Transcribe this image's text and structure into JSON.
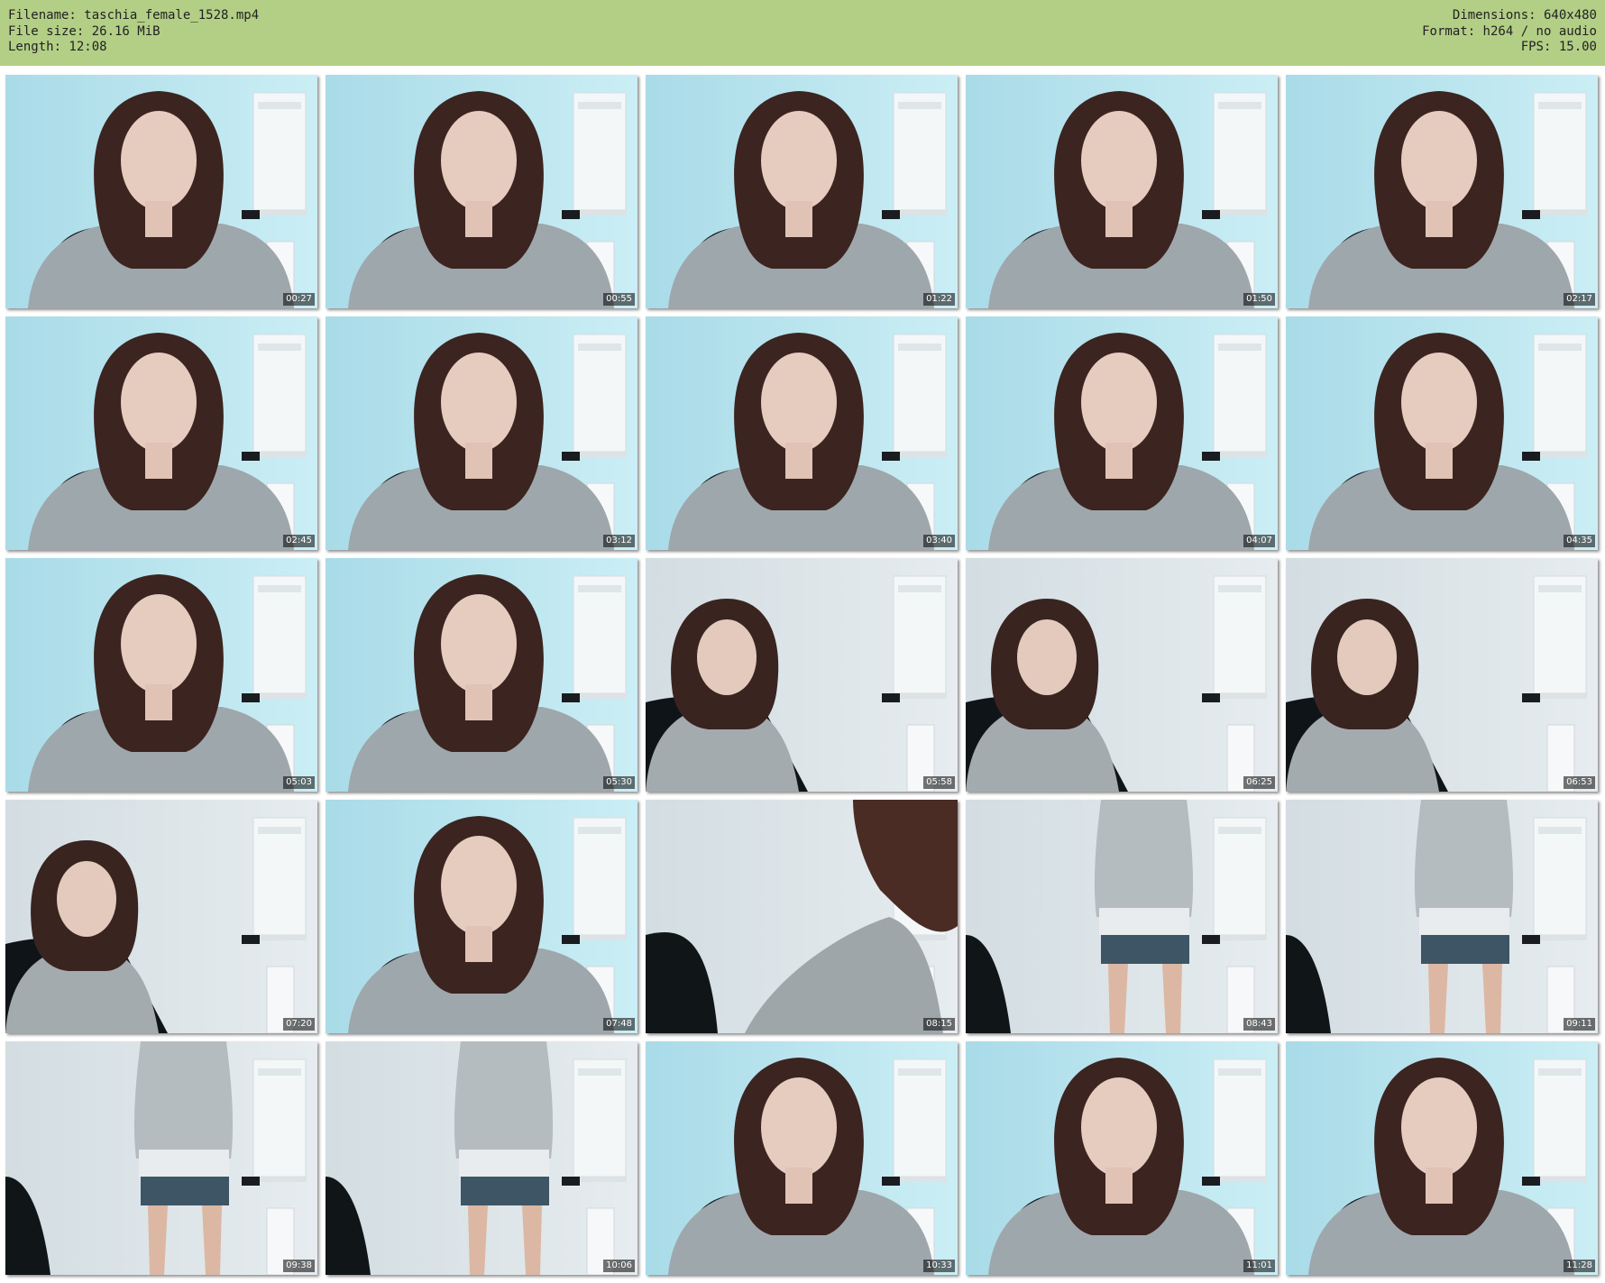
{
  "header": {
    "filename": "Filename: taschia_female_1528.mp4",
    "filesize": "File size: 26.16 MiB",
    "length": "Length: 12:08",
    "dimensions": "Dimensions: 640x480",
    "format": "Format: h264 / no audio",
    "fps": "FPS: 15.00"
  },
  "thumbnails": [
    {
      "time": "00:27",
      "scene": "face"
    },
    {
      "time": "00:55",
      "scene": "face"
    },
    {
      "time": "01:22",
      "scene": "face"
    },
    {
      "time": "01:50",
      "scene": "face"
    },
    {
      "time": "02:17",
      "scene": "face"
    },
    {
      "time": "02:45",
      "scene": "face"
    },
    {
      "time": "03:12",
      "scene": "face"
    },
    {
      "time": "03:40",
      "scene": "face"
    },
    {
      "time": "04:07",
      "scene": "face"
    },
    {
      "time": "04:35",
      "scene": "face"
    },
    {
      "time": "05:03",
      "scene": "face"
    },
    {
      "time": "05:30",
      "scene": "face"
    },
    {
      "time": "05:58",
      "scene": "seated-left"
    },
    {
      "time": "06:25",
      "scene": "seated-left"
    },
    {
      "time": "06:53",
      "scene": "seated-left"
    },
    {
      "time": "07:20",
      "scene": "seated-left"
    },
    {
      "time": "07:48",
      "scene": "face"
    },
    {
      "time": "08:15",
      "scene": "blur"
    },
    {
      "time": "08:43",
      "scene": "standing"
    },
    {
      "time": "09:11",
      "scene": "standing"
    },
    {
      "time": "09:38",
      "scene": "standing"
    },
    {
      "time": "10:06",
      "scene": "standing"
    },
    {
      "time": "10:33",
      "scene": "face"
    },
    {
      "time": "11:01",
      "scene": "face"
    },
    {
      "time": "11:28",
      "scene": "face"
    }
  ]
}
